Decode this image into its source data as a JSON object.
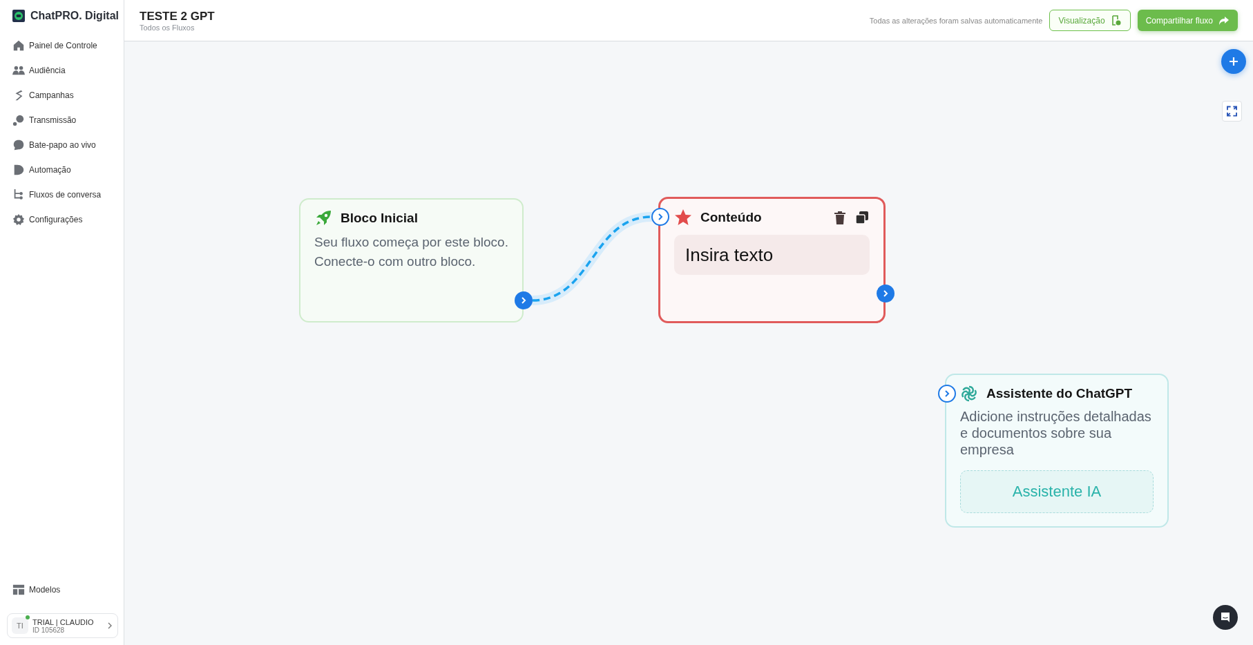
{
  "sidebar": {
    "brand": "ChatPRO. Digital",
    "items": [
      {
        "label": "Painel de Controle"
      },
      {
        "label": "Audiência"
      },
      {
        "label": "Campanhas"
      },
      {
        "label": "Transmissão"
      },
      {
        "label": "Bate-papo ao vivo"
      },
      {
        "label": "Automação"
      },
      {
        "label": "Fluxos de conversa"
      },
      {
        "label": "Configurações"
      }
    ],
    "bottom_items": [
      {
        "label": "Modelos"
      }
    ],
    "account": {
      "initials": "TI",
      "name": "TRIAL | CLAUDIO",
      "id": "ID 105628",
      "online": true
    }
  },
  "header": {
    "title": "TESTE 2 GPT",
    "breadcrumb": "Todos os Fluxos",
    "save_status": "Todas as alterações foram salvas automaticamente",
    "buttons": [
      {
        "label": "Visualização",
        "kind": "outline"
      },
      {
        "label": "Compartilhar fluxo",
        "kind": "primary"
      }
    ]
  },
  "canvas": {
    "nodes": [
      {
        "kind": "start",
        "title": "Bloco Inicial",
        "text": "Seu fluxo começa por este bloco. Conecte-o com outro bloco.",
        "selected": false,
        "connected_to_next": true
      },
      {
        "kind": "content",
        "title": "Conteúdo",
        "placeholder": "Insira texto",
        "selected": true
      },
      {
        "kind": "ai",
        "title": "Assistente do ChatGPT",
        "text": "Adicione instruções detalhadas e documentos sobre sua empresa",
        "action": "Assistente IA",
        "selected": false
      }
    ]
  }
}
